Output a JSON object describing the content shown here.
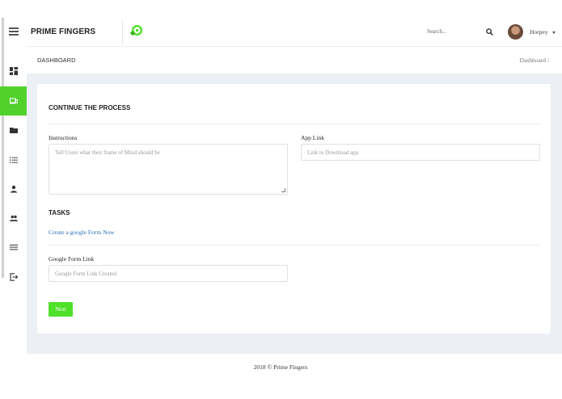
{
  "header": {
    "brand": "PRIME FINGERS",
    "search_placeholder": "Search...",
    "username": "Horpey"
  },
  "breadcrumb": {
    "title": "DASHBOARD",
    "trail": "Dashboard /"
  },
  "sidebar": {
    "items": [
      {
        "icon": "dashboard-icon"
      },
      {
        "icon": "devices-icon",
        "active": true
      },
      {
        "icon": "folder-icon"
      },
      {
        "icon": "list-icon"
      },
      {
        "icon": "person-icon"
      },
      {
        "icon": "group-icon"
      },
      {
        "icon": "menu-icon"
      },
      {
        "icon": "logout-icon"
      }
    ],
    "active_color": "#51d12b"
  },
  "form": {
    "title": "CONTINUE THE PROCESS",
    "instructions_label": "Instructions",
    "instructions_placeholder": "Tell Users what their frame of Mind should be",
    "app_link_label": "App Link",
    "app_link_placeholder": "Link to Download app",
    "tasks_title": "TASKS",
    "google_form_link_text": "Create a google Form Now",
    "google_form_label": "Google Form Link",
    "google_form_placeholder": "Google Form Link Created",
    "next_label": "Next"
  },
  "footer": {
    "text": "2018 © Prime Fingers"
  },
  "colors": {
    "accent": "#4fe02a",
    "link": "#2d6fb5",
    "content_bg": "#ecf0f4"
  }
}
